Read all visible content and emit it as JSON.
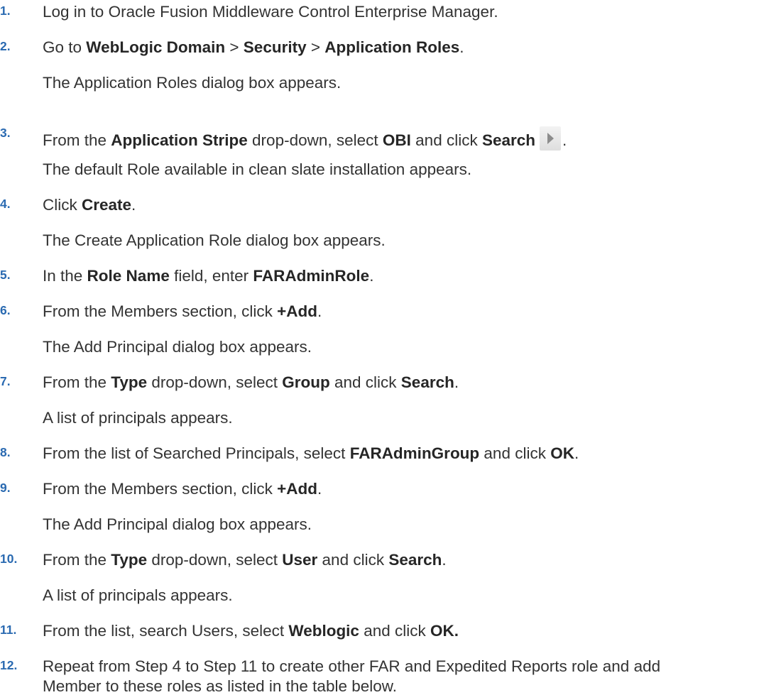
{
  "steps": [
    {
      "num": "1.",
      "parts": [
        "Log in to Oracle Fusion Middleware Control Enterprise Manager."
      ]
    },
    {
      "num": "2.",
      "parts": [
        "Go to ",
        "WebLogic Domain",
        " > ",
        "Security",
        " > ",
        "Application Roles",
        "."
      ],
      "note": "The Application Roles dialog box appears."
    },
    {
      "num": "3.",
      "parts": [
        "From the ",
        "Application Stripe",
        " drop-down, select ",
        "OBI",
        " and click ",
        "Search",
        "."
      ],
      "icon": "search-arrow-icon",
      "note": "The default Role available in clean slate installation appears."
    },
    {
      "num": "4.",
      "parts": [
        "Click ",
        "Create",
        "."
      ],
      "note": "The Create Application Role dialog box appears."
    },
    {
      "num": "5.",
      "parts": [
        "In the ",
        "Role Name",
        " field, enter ",
        "FARAdminRole",
        "."
      ]
    },
    {
      "num": "6.",
      "parts": [
        "From the Members section, click ",
        "+Add",
        "."
      ],
      "note": "The Add Principal dialog box appears."
    },
    {
      "num": "7.",
      "parts": [
        "From the ",
        "Type",
        " drop-down, select ",
        "Group",
        " and click ",
        "Search",
        "."
      ],
      "note": "A list of principals appears."
    },
    {
      "num": "8.",
      "parts": [
        "From the list of Searched Principals, select ",
        "FARAdminGroup",
        " and click ",
        "OK",
        "."
      ]
    },
    {
      "num": "9.",
      "parts": [
        "From the Members section, click ",
        "+Add",
        "."
      ],
      "note": "The Add Principal dialog box appears."
    },
    {
      "num": "10.",
      "parts": [
        "From the ",
        "Type",
        " drop-down, select ",
        "User",
        " and click ",
        "Search",
        "."
      ],
      "note": "A list of principals appears."
    },
    {
      "num": "11.",
      "parts": [
        "From the list, search Users, select ",
        "Weblogic",
        " and click ",
        "OK."
      ]
    },
    {
      "num": "12.",
      "parts": [
        "Repeat from Step 4 to Step 11 to create other FAR and Expedited Reports role and add"
      ],
      "cont": "Member to these roles as listed in the table below."
    }
  ],
  "colors": {
    "text": "#333333",
    "step_number": "#2a6ab1",
    "bold": "#262626"
  }
}
